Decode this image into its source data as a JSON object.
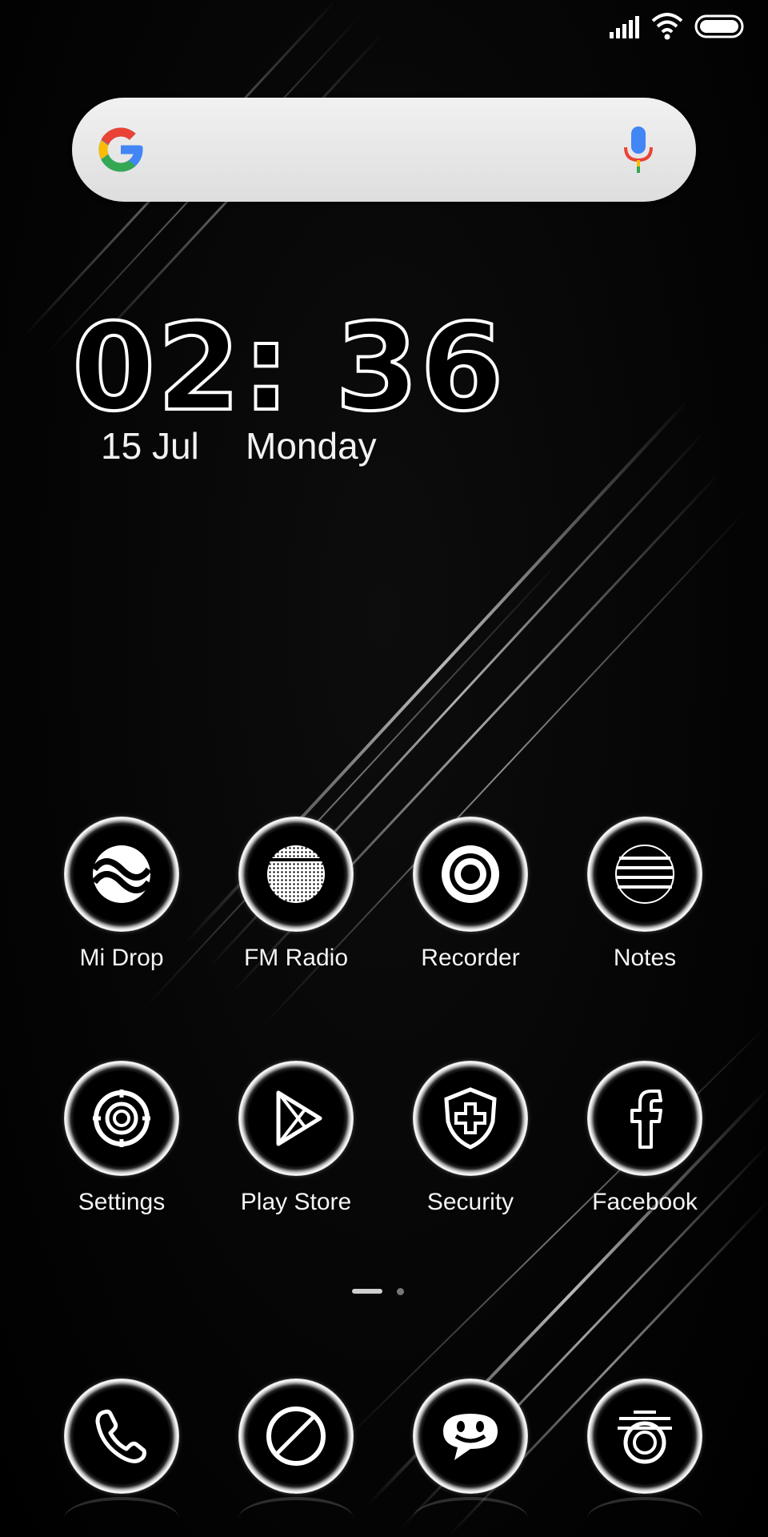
{
  "status_bar": {
    "signal_icon": "signal-bars-icon",
    "wifi_icon": "wifi-icon",
    "battery_icon": "battery-icon"
  },
  "search": {
    "logo_icon": "google-logo-icon",
    "mic_icon": "microphone-icon"
  },
  "clock": {
    "time": "02: 36",
    "date": "15 Jul",
    "day": "Monday"
  },
  "apps": [
    {
      "label": "Mi Drop",
      "icon": "mi-drop-icon"
    },
    {
      "label": "FM Radio",
      "icon": "radio-icon"
    },
    {
      "label": "Recorder",
      "icon": "recorder-icon"
    },
    {
      "label": "Notes",
      "icon": "notes-icon"
    },
    {
      "label": "Settings",
      "icon": "gear-icon"
    },
    {
      "label": "Play Store",
      "icon": "play-store-icon"
    },
    {
      "label": "Security",
      "icon": "shield-icon"
    },
    {
      "label": "Facebook",
      "icon": "facebook-icon"
    }
  ],
  "dock": [
    {
      "icon": "phone-icon"
    },
    {
      "icon": "browser-icon"
    },
    {
      "icon": "messages-icon"
    },
    {
      "icon": "camera-icon"
    }
  ],
  "page_indicator": {
    "pages": 2,
    "current": 1
  },
  "colors": {
    "background": "#000000",
    "foreground": "#ffffff",
    "search_bar": "#e8e8e8"
  }
}
